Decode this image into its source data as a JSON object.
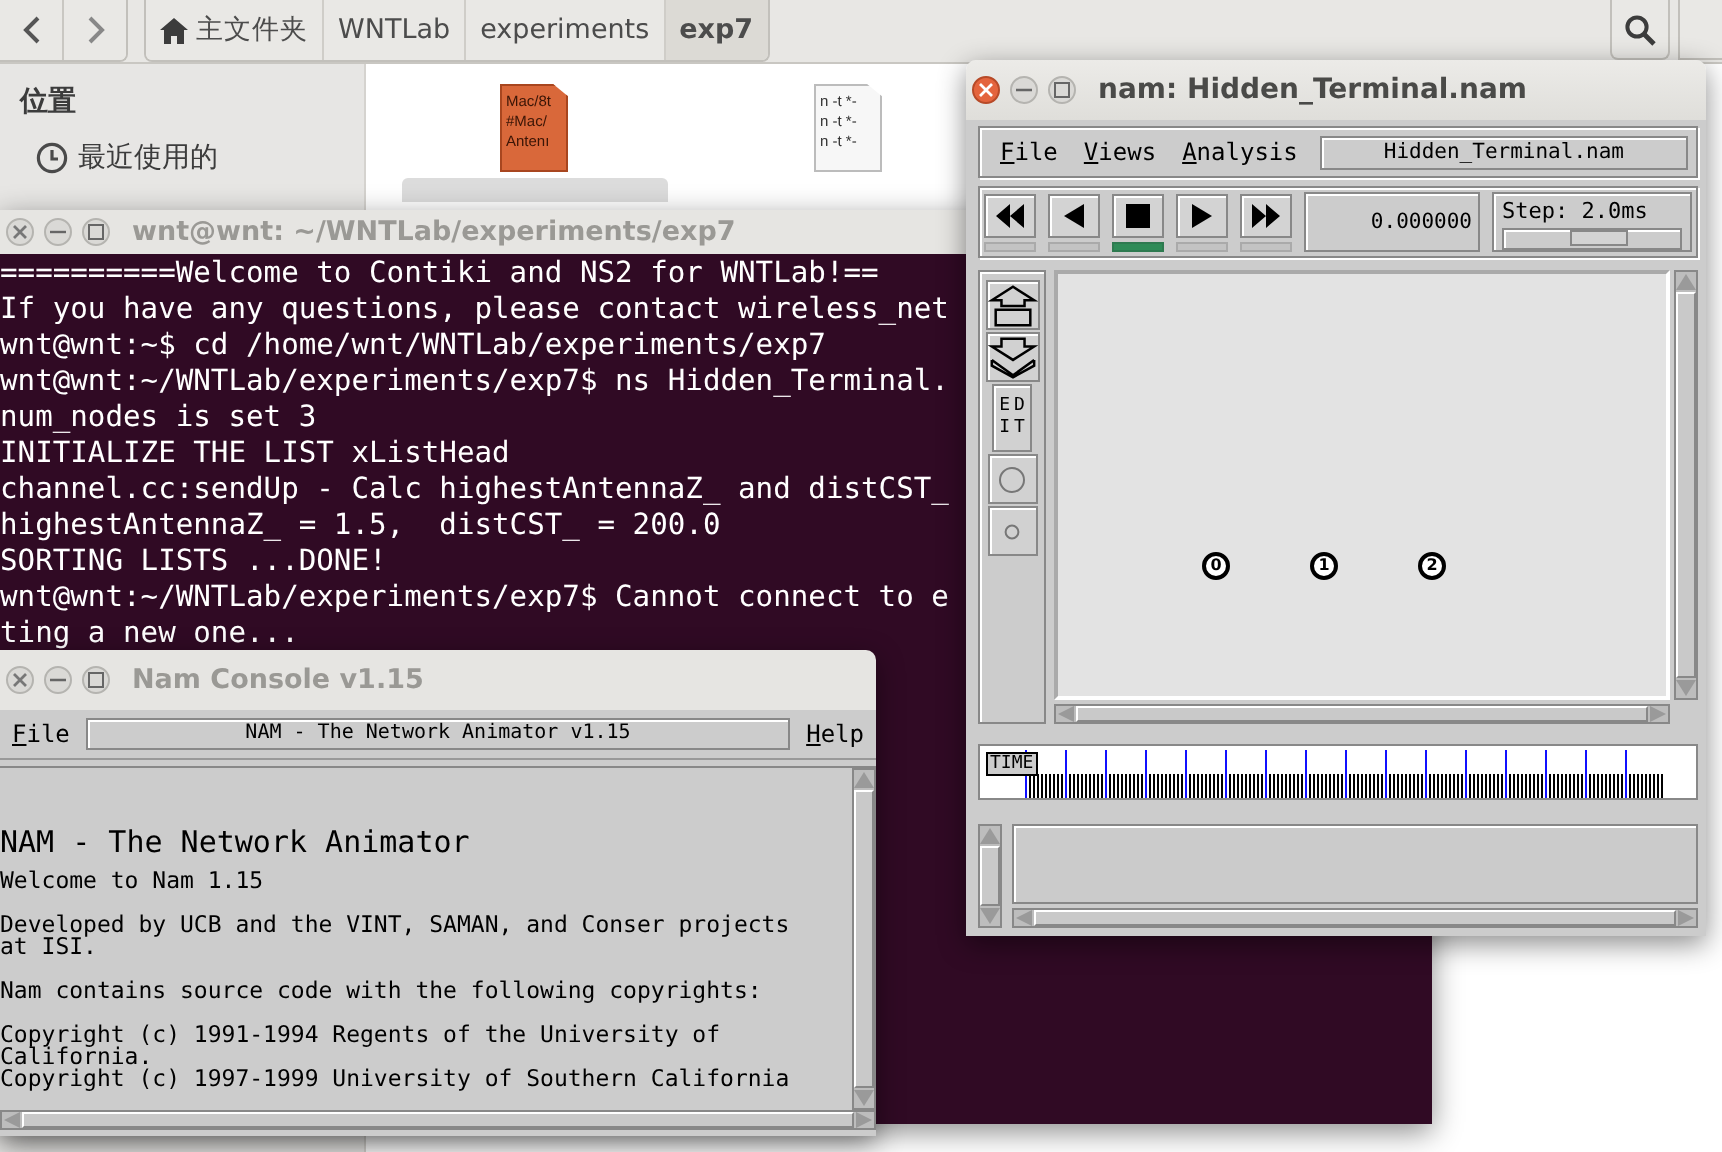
{
  "file_manager": {
    "breadcrumbs": [
      {
        "label": "主文件夹",
        "kind": "home",
        "selected": false
      },
      {
        "label": "WNTLab",
        "kind": "folder",
        "selected": false
      },
      {
        "label": "experiments",
        "kind": "folder",
        "selected": false
      },
      {
        "label": "exp7",
        "kind": "folder",
        "selected": true
      }
    ],
    "sidebar": {
      "heading": "位置",
      "items": [
        {
          "label": "最近使用的",
          "kind": "recent"
        }
      ]
    },
    "files": [
      {
        "kind": "script",
        "selected": true,
        "preview": [
          "Mac/8t",
          "#Mac/",
          "Antenı"
        ]
      },
      {
        "kind": "trace",
        "selected": false,
        "preview": [
          "n -t *-",
          "n -t *-",
          "n -t *-"
        ]
      }
    ]
  },
  "terminal": {
    "title": "wnt@wnt: ~/WNTLab/experiments/exp7",
    "focused": false,
    "lines": [
      "==========Welcome to Contiki and NS2 for WNTLab!==",
      "If you have any questions, please contact wireless_net",
      "wnt@wnt:~$ cd /home/wnt/WNTLab/experiments/exp7",
      "wnt@wnt:~/WNTLab/experiments/exp7$ ns Hidden_Terminal.",
      "num_nodes is set 3",
      "INITIALIZE THE LIST xListHead",
      "channel.cc:sendUp - Calc highestAntennaZ_ and distCST_",
      "highestAntennaZ_ = 1.5,  distCST_ = 200.0",
      "SORTING LISTS ...DONE!",
      "wnt@wnt:~/WNTLab/experiments/exp7$ Cannot connect to e",
      "ting a new one..."
    ]
  },
  "nam_console": {
    "title": "Nam Console v1.15",
    "focused": false,
    "menu": [
      "File",
      "Help"
    ],
    "banner": "NAM - The Network Animator v1.15",
    "heading": "NAM - The Network Animator",
    "paragraphs": [
      "Welcome to Nam 1.15",
      "Developed by UCB and the VINT, SAMAN, and Conser projects\nat ISI.",
      "Nam contains source code with the following copyrights:",
      "Copyright (c) 1991-1994 Regents of the University of\nCalifornia.\nCopyright (c) 1997-1999 University of Southern California"
    ]
  },
  "nam": {
    "title": "nam: Hidden_Terminal.nam",
    "focused": true,
    "menu": [
      "File",
      "Views",
      "Analysis"
    ],
    "file_field": "Hidden_Terminal.nam",
    "transport": [
      {
        "kind": "rewind",
        "selected": false
      },
      {
        "kind": "back",
        "selected": false
      },
      {
        "kind": "stop",
        "selected": true
      },
      {
        "kind": "play",
        "selected": false
      },
      {
        "kind": "forward",
        "selected": false
      }
    ],
    "time": "0.000000",
    "step": {
      "label": "Step: 2.0ms",
      "level": 0.55
    },
    "tools": [
      {
        "kind": "zoom-in"
      },
      {
        "kind": "zoom-out"
      },
      {
        "kind": "edit",
        "label": "EDIT"
      },
      {
        "kind": "large-node"
      },
      {
        "kind": "small-node"
      }
    ],
    "nodes": [
      {
        "label": "0"
      },
      {
        "label": "1"
      },
      {
        "label": "2"
      }
    ],
    "timeline_label": "TIME"
  }
}
